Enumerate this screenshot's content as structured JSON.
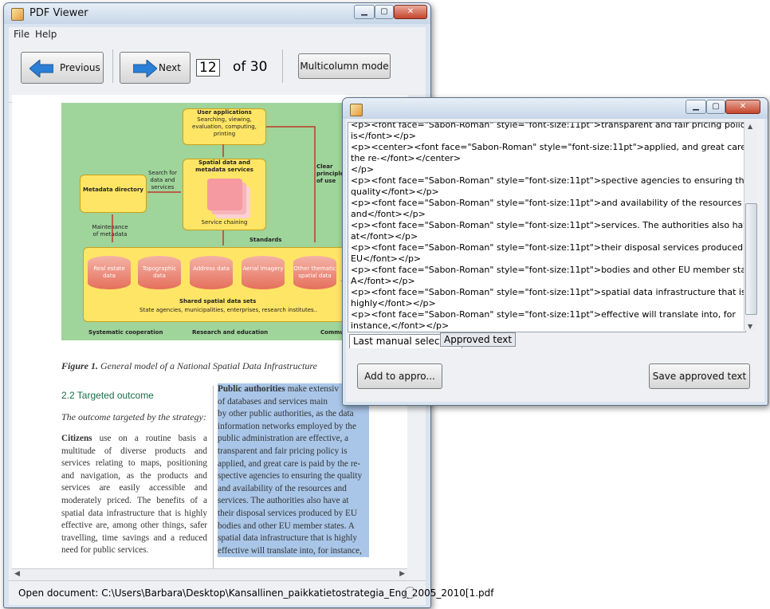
{
  "main_window": {
    "title": "PDF Viewer",
    "menu": [
      "File",
      "Help"
    ],
    "toolbar": {
      "previous_label": "Previous",
      "next_label": "Next",
      "page_number": "12",
      "of_total": "of 30",
      "multicolumn_label": "Multicolumn mode"
    },
    "status_text": "Open document: C:\\Users\\Barbara\\Desktop\\Kansallinen_paikkatietostrategia_Eng_2005_2010[1.pdf"
  },
  "document": {
    "diagram": {
      "user_applications_title": "User applications",
      "user_applications_body": "Searching, viewing, evaluation, computing, printing",
      "spatial_services_title": "Spatial data and metadata services",
      "service_chaining": "Service chaining",
      "metadata_directory": "Metadata directory",
      "search_label": "Search for data and services",
      "maintenance_label": "Maintenance of metadata",
      "clear_principles": "Clear principles of use",
      "standards": "Standards",
      "datasets": [
        "Real estate data",
        "Topographic data",
        "Address data",
        "Aerial imagery",
        "Other thematic spatial data"
      ],
      "ellipsis": "....",
      "shared_title": "Shared spatial data sets",
      "shared_body": "State agencies, municipalities, enterprises, research institutes..",
      "bottom": [
        "Systematic cooperation",
        "Research and education",
        "Communicat"
      ]
    },
    "figure_label": "Figure 1.",
    "figure_caption": "General model of a National Spatial Data Infrastructure",
    "section_heading": "2.2 Targeted outcome",
    "section_sub": "The outcome targeted by the strategy:",
    "col1_bold": "Citizens",
    "col1_text": "use on a routine basis a multitude of diverse products and services relating to maps, positioning and navigation, as the products and services are easily accessible and moderately priced. The benefits of a spatial data infrastructure that is highly effective are, among other things, safer travelling, time savings and a reduced need for public services.",
    "col2_bold": "Public authorities",
    "col2_first": " make extensiv",
    "col2_lines": [
      "of databases and services main",
      "by other public authorities, as the data",
      "information networks employed by the",
      "public administration are effective, a",
      "transparent and fair pricing policy is",
      "applied, and great care is paid by the re-",
      "spective agencies to ensuring the quality",
      "and availability of the resources and",
      "services. The authorities also have at",
      "their disposal services produced by EU",
      "bodies and other EU member states. A",
      "spatial data infrastructure that is highly",
      "effective will translate into, for instance,"
    ]
  },
  "popup": {
    "html_lines": [
      "<p><font face=\"Sabon-Roman\" style=\"font-size:11pt\">transparent and fair pricing policy",
      "is</font></p>",
      "<p><center><font face=\"Sabon-Roman\" style=\"font-size:11pt\">applied, and great care is paid by",
      "the re-</font></center>",
      "</p>",
      "<p><font face=\"Sabon-Roman\" style=\"font-size:11pt\">spective agencies to ensuring the",
      "quality</font></p>",
      "<p><font face=\"Sabon-Roman\" style=\"font-size:11pt\">and availability of the resources",
      "and</font></p>",
      "<p><font face=\"Sabon-Roman\" style=\"font-size:11pt\">services. The authorities also have",
      "at</font></p>",
      "<p><font face=\"Sabon-Roman\" style=\"font-size:11pt\">their disposal services produced by",
      "EU</font></p>",
      "<p><font face=\"Sabon-Roman\" style=\"font-size:11pt\">bodies and other EU member states.",
      "A</font></p>",
      "<p><font face=\"Sabon-Roman\" style=\"font-size:11pt\">spatial data infrastructure that is",
      "highly</font></p>",
      "<p><font face=\"Sabon-Roman\" style=\"font-size:11pt\">effective will translate into, for",
      "instance,</font></p>"
    ],
    "tabs": [
      "Last manual selection",
      "Approved text"
    ],
    "add_button": "Add to appro...",
    "save_button": "Save approved text"
  }
}
